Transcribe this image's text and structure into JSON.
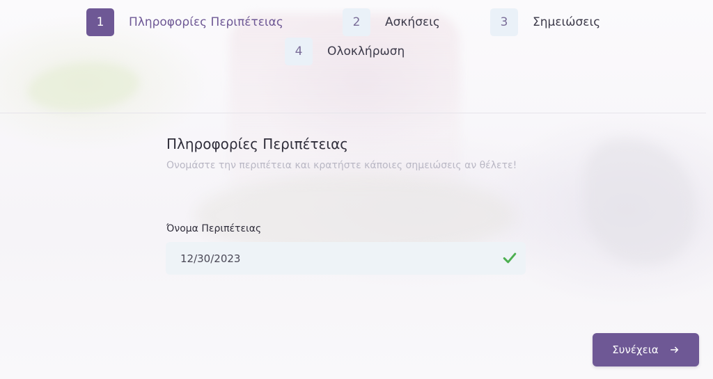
{
  "stepper": {
    "steps": [
      {
        "number": "1",
        "label": "Πληροφορίες Περιπέτειας",
        "active": true
      },
      {
        "number": "2",
        "label": "Ασκήσεις",
        "active": false
      },
      {
        "number": "3",
        "label": "Σημειώσεις",
        "active": false
      },
      {
        "number": "4",
        "label": "Ολοκλήρωση",
        "active": false
      }
    ]
  },
  "form": {
    "title": "Πληροφορίες Περιπέτειας",
    "subtitle": "Ονομάστε την περιπέτεια και κρατήστε κάποιες σημειώσεις αν θέλετε!",
    "name_label": "Όνομα Περιπέτειας",
    "name_value": "12/30/2023",
    "valid_icon": "check-icon"
  },
  "actions": {
    "next_label": "Συνέχεια",
    "next_icon": "arrow-right-icon"
  },
  "colors": {
    "accent": "#6e5895",
    "success": "#4caf50",
    "step_inactive_bg": "#eaf1f8"
  }
}
